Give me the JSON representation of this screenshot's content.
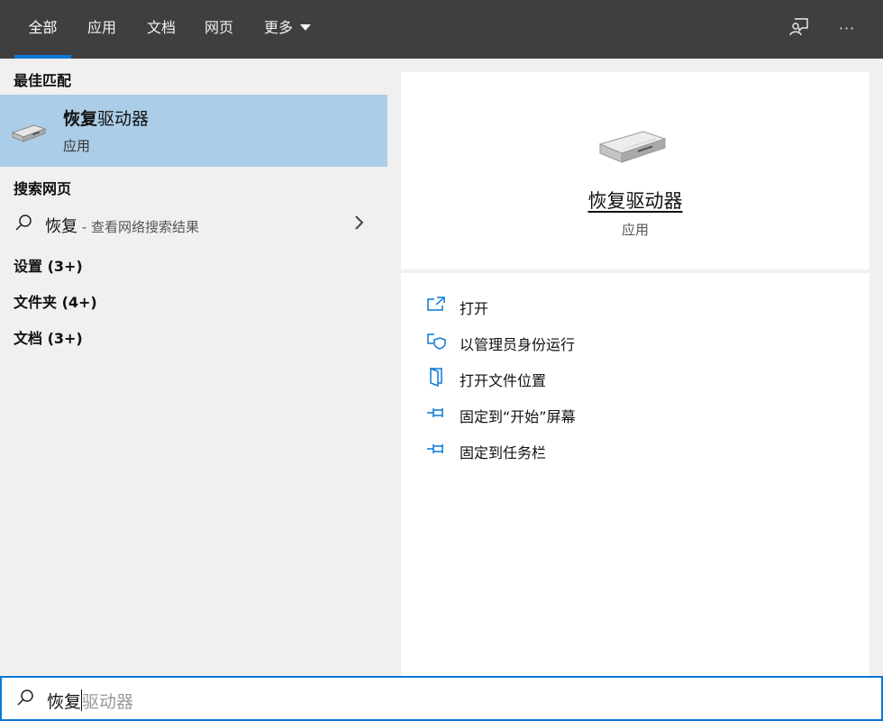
{
  "tabs": [
    {
      "label": "全部",
      "active": true
    },
    {
      "label": "应用",
      "active": false
    },
    {
      "label": "文档",
      "active": false
    },
    {
      "label": "网页",
      "active": false
    },
    {
      "label": "更多",
      "active": false
    }
  ],
  "top_icons": {
    "feedback": "feedback-icon",
    "more": "more-options-icon",
    "more_glyph": "···"
  },
  "left": {
    "best_match_title": "最佳匹配",
    "best_match": {
      "name_bold": "恢复",
      "name_rest": "驱动器",
      "type": "应用",
      "icon": "drive-icon"
    },
    "web_title": "搜索网页",
    "web_result": {
      "query": "恢复",
      "hint": " - 查看网络搜索结果"
    },
    "settings_group": "设置 (3+)",
    "folders_group": "文件夹 (4+)",
    "docs_group": "文档 (3+)"
  },
  "preview": {
    "title": "恢复驱动器",
    "subtitle": "应用",
    "actions": [
      {
        "label": "打开",
        "icon": "open-icon"
      },
      {
        "label": "以管理员身份运行",
        "icon": "admin-shield-icon"
      },
      {
        "label": "打开文件位置",
        "icon": "file-location-icon"
      },
      {
        "label": "固定到“开始”屏幕",
        "icon": "pin-icon"
      },
      {
        "label": "固定到任务栏",
        "icon": "pin-icon"
      }
    ]
  },
  "search": {
    "typed": "恢复",
    "suggestion": "驱动器"
  },
  "colors": {
    "accent": "#0a78d7",
    "topbar": "#3f3f3f",
    "selected": "#abcde8"
  }
}
